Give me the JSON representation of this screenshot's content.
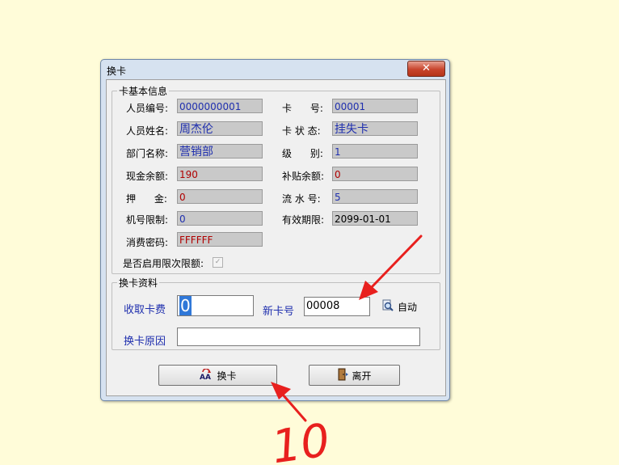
{
  "window": {
    "title": "换卡",
    "close_label": "✕"
  },
  "card_info": {
    "legend": "卡基本信息",
    "left": [
      {
        "label": "人员编号:",
        "value": "0000000001",
        "color": "#1F2FAE"
      },
      {
        "label": "人员姓名:",
        "value": "周杰伦",
        "color": "#1F2FAE"
      },
      {
        "label": "部门名称:",
        "value": "营销部",
        "color": "#1F2FAE"
      },
      {
        "label": "现金余额:",
        "value": "190",
        "color": "#B00000"
      },
      {
        "label": "押      金:",
        "value": "0",
        "color": "#B00000"
      },
      {
        "label": "机号限制:",
        "value": "0",
        "color": "#1F2FAE"
      },
      {
        "label": "消费密码:",
        "value": "FFFFFF",
        "color": "#B00000"
      }
    ],
    "right": [
      {
        "label": "卡      号:",
        "value": "00001",
        "color": "#1F2FAE"
      },
      {
        "label": "卡 状 态:",
        "value": "挂失卡",
        "color": "#1F2FAE"
      },
      {
        "label": "级      别:",
        "value": "1",
        "color": "#1F2FAE"
      },
      {
        "label": "补贴余额:",
        "value": "0",
        "color": "#B00000"
      },
      {
        "label": "流 水 号:",
        "value": "5",
        "color": "#1F2FAE"
      },
      {
        "label": "有效期限:",
        "value": "2099-01-01",
        "color": "#000000"
      }
    ],
    "limit_check_label": "是否启用限次限额:",
    "limit_check_mark": "✓"
  },
  "replace_info": {
    "legend": "换卡资料",
    "fee_label": "收取卡费",
    "fee_value": "0",
    "new_card_label": "新卡号",
    "new_card_value": "00008",
    "auto_label": "自动",
    "reason_label": "换卡原因",
    "reason_value": ""
  },
  "buttons": {
    "replace_label": "换卡",
    "leave_label": "离开"
  },
  "annotation": {
    "text": "10",
    "color": "#E8201E"
  }
}
